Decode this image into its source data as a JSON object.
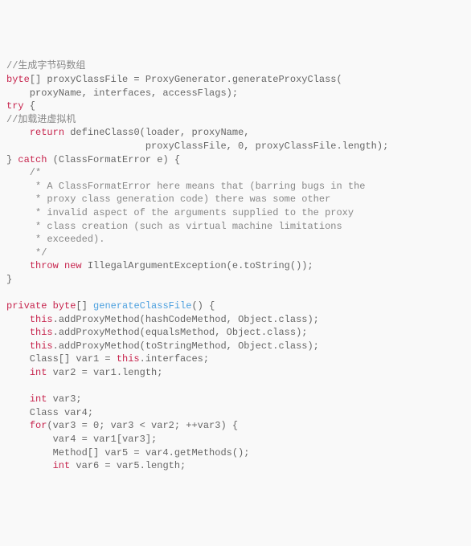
{
  "lines": {
    "l1": "//生成字节码数组",
    "l2a": "byte",
    "l2b": "[] proxyClassFile = ProxyGenerator.generateProxyClass(",
    "l3": "    proxyName, interfaces, accessFlags);",
    "l4a": "try",
    "l4b": " {",
    "l5": "//加载进虚拟机",
    "l6a": "    ",
    "l6b": "return",
    "l6c": " defineClass0(loader, proxyName,",
    "l7": "                        proxyClassFile, 0, proxyClassFile.length);",
    "l8a": "} ",
    "l8b": "catch",
    "l8c": " (ClassFormatError e) {",
    "l9": "    /*",
    "l10": "     * A ClassFormatError here means that (barring bugs in the",
    "l11": "     * proxy class generation code) there was some other",
    "l12": "     * invalid aspect of the arguments supplied to the proxy",
    "l13": "     * class creation (such as virtual machine limitations",
    "l14": "     * exceeded).",
    "l15": "     */",
    "l16a": "    ",
    "l16b": "throw",
    "l16c": " ",
    "l16d": "new",
    "l16e": " IllegalArgumentException(e.toString());",
    "l17": "}",
    "l18": "",
    "l19a": "private",
    "l19b": " ",
    "l19c": "byte",
    "l19d": "[] ",
    "l19e": "generateClassFile",
    "l19f": "() {",
    "l20a": "    ",
    "l20b": "this",
    "l20c": ".addProxyMethod(hashCodeMethod, Object.class);",
    "l21a": "    ",
    "l21b": "this",
    "l21c": ".addProxyMethod(equalsMethod, Object.class);",
    "l22a": "    ",
    "l22b": "this",
    "l22c": ".addProxyMethod(toStringMethod, Object.class);",
    "l23a": "    Class[] var1 = ",
    "l23b": "this",
    "l23c": ".interfaces;",
    "l24a": "    ",
    "l24b": "int",
    "l24c": " var2 = var1.length;",
    "l25": "",
    "l26a": "    ",
    "l26b": "int",
    "l26c": " var3;",
    "l27": "    Class var4;",
    "l28a": "    ",
    "l28b": "for",
    "l28c": "(var3 = 0; var3 < var2; ++var3) {",
    "l29": "        var4 = var1[var3];",
    "l30": "        Method[] var5 = var4.getMethods();",
    "l31a": "        ",
    "l31b": "int",
    "l31c": " var6 = var5.length;"
  }
}
